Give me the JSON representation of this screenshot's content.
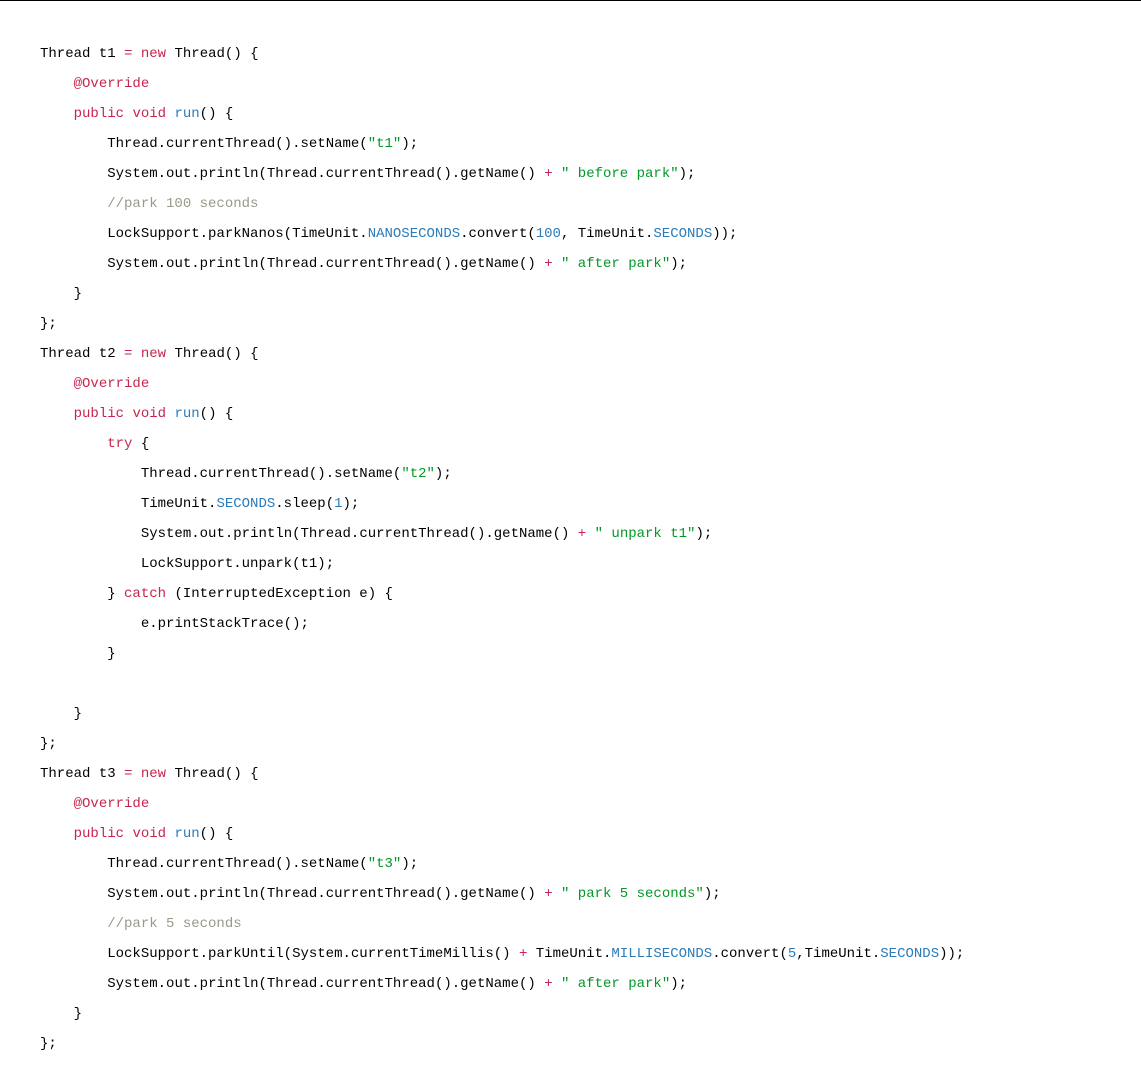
{
  "code": {
    "kw_new": "new",
    "kw_public": "public",
    "kw_void": "void",
    "kw_try": "try",
    "kw_catch": "catch",
    "type_Thread": "Thread",
    "type_System": "System",
    "type_LockSupport": "LockSupport",
    "type_TimeUnit": "TimeUnit",
    "type_InterruptedException": "InterruptedException",
    "ident_t1": "t1",
    "ident_t2": "t2",
    "ident_t3": "t3",
    "ident_out": "out",
    "ident_e": "e",
    "annotation_override": "@Override",
    "method_run": "run",
    "method_currentThread": "currentThread",
    "method_setName": "setName",
    "method_println": "println",
    "method_getName": "getName",
    "method_parkNanos": "parkNanos",
    "method_convert": "convert",
    "method_sleep": "sleep",
    "method_unpark": "unpark",
    "method_printStackTrace": "printStackTrace",
    "method_parkUntil": "parkUntil",
    "method_currentTimeMillis": "currentTimeMillis",
    "const_NANOSECONDS": "NANOSECONDS",
    "const_SECONDS": "SECONDS",
    "const_MILLISECONDS": "MILLISECONDS",
    "str_t1": "\"t1\"",
    "str_t2": "\"t2\"",
    "str_t3": "\"t3\"",
    "str_before_park": "\" before park\"",
    "str_after_park": "\" after park\"",
    "str_unpark_t1": "\" unpark t1\"",
    "str_park5": "\" park 5 seconds\"",
    "num_100": "100",
    "num_1": "1",
    "num_5": "5",
    "comment_park100": "//park 100 seconds",
    "comment_park5": "//park 5 seconds",
    "op_assign": "=",
    "op_plus": "+",
    "p_lparen": "(",
    "p_rparen": ")",
    "p_lbrace": "{",
    "p_rbrace": "}",
    "p_rbrace_semi": "};",
    "p_dot": ".",
    "p_comma": ",",
    "p_semi": ";",
    "p_space": " "
  }
}
